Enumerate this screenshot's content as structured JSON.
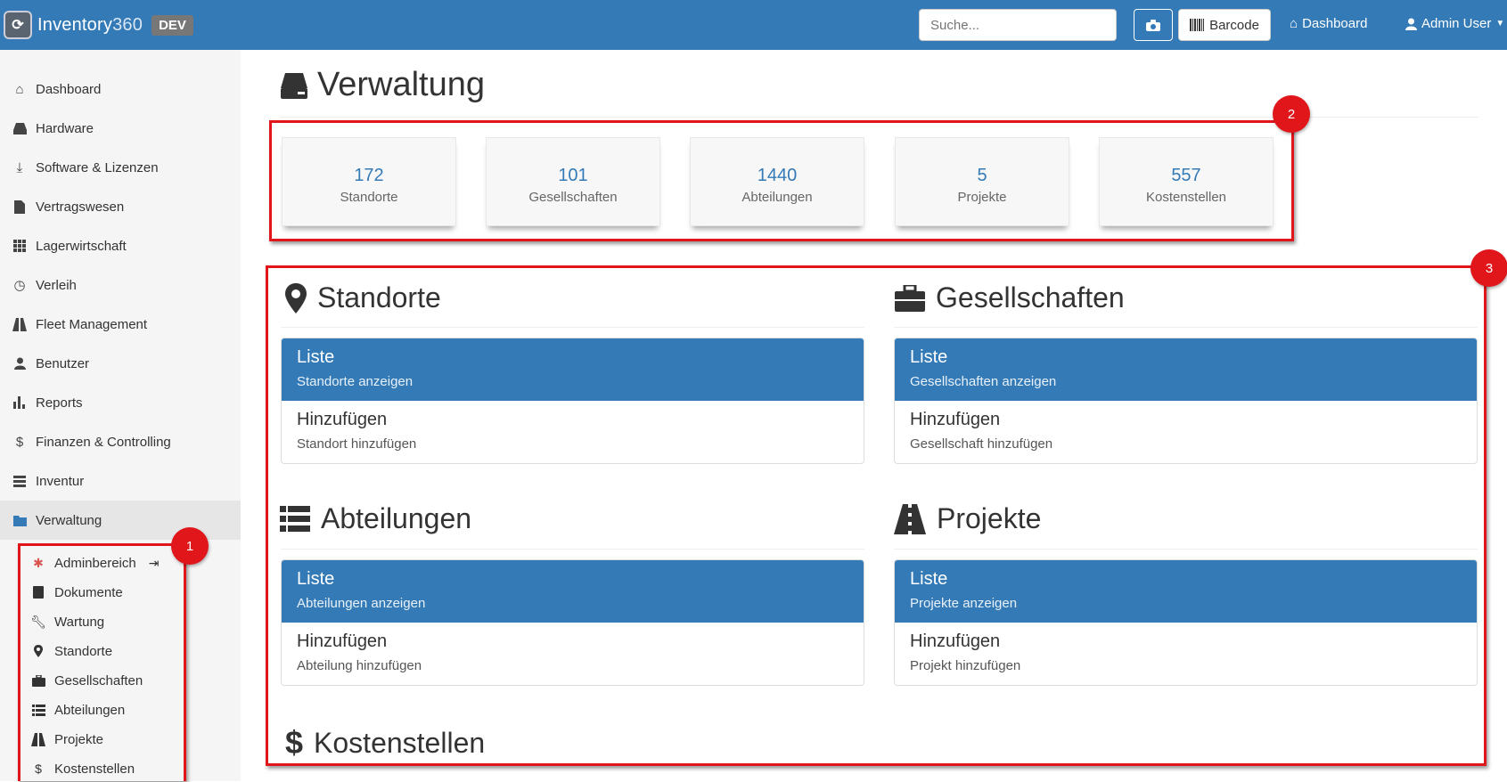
{
  "topbar": {
    "brand_name": "Inventory",
    "brand_num": "360",
    "env_badge": "DEV",
    "search_placeholder": "Suche...",
    "barcode_label": "Barcode",
    "dashboard_label": "Dashboard",
    "user_label": "Admin User"
  },
  "sidebar": {
    "items": [
      {
        "label": "Dashboard",
        "icon": "home-icon"
      },
      {
        "label": "Hardware",
        "icon": "drive-icon"
      },
      {
        "label": "Software & Lizenzen",
        "icon": "download-icon"
      },
      {
        "label": "Vertragswesen",
        "icon": "file-icon"
      },
      {
        "label": "Lagerwirtschaft",
        "icon": "grid-icon"
      },
      {
        "label": "Verleih",
        "icon": "clock-icon"
      },
      {
        "label": "Fleet Management",
        "icon": "road-icon"
      },
      {
        "label": "Benutzer",
        "icon": "user-icon"
      },
      {
        "label": "Reports",
        "icon": "chart-icon"
      },
      {
        "label": "Finanzen & Controlling",
        "icon": "dollar-icon"
      },
      {
        "label": "Inventur",
        "icon": "list-icon"
      },
      {
        "label": "Verwaltung",
        "icon": "folder-icon"
      }
    ],
    "subitems": [
      {
        "label": "Adminbereich",
        "icon": "cog-icon"
      },
      {
        "label": "Dokumente",
        "icon": "book-icon"
      },
      {
        "label": "Wartung",
        "icon": "wrench-icon"
      },
      {
        "label": "Standorte",
        "icon": "map-marker-icon"
      },
      {
        "label": "Gesellschaften",
        "icon": "briefcase-icon"
      },
      {
        "label": "Abteilungen",
        "icon": "list-icon"
      },
      {
        "label": "Projekte",
        "icon": "road-icon"
      },
      {
        "label": "Kostenstellen",
        "icon": "dollar-icon"
      }
    ]
  },
  "main": {
    "title": "Verwaltung",
    "stats": [
      {
        "value": "172",
        "label": "Standorte"
      },
      {
        "value": "101",
        "label": "Gesellschaften"
      },
      {
        "value": "1440",
        "label": "Abteilungen"
      },
      {
        "value": "5",
        "label": "Projekte"
      },
      {
        "value": "557",
        "label": "Kostenstellen"
      }
    ],
    "sections": [
      {
        "title": "Standorte",
        "icon": "map-marker-icon",
        "list_h": "Liste",
        "list_s": "Standorte anzeigen",
        "add_h": "Hinzufügen",
        "add_s": "Standort hinzufügen"
      },
      {
        "title": "Gesellschaften",
        "icon": "briefcase-icon",
        "list_h": "Liste",
        "list_s": "Gesellschaften anzeigen",
        "add_h": "Hinzufügen",
        "add_s": "Gesellschaft hinzufügen"
      },
      {
        "title": "Abteilungen",
        "icon": "list-icon",
        "list_h": "Liste",
        "list_s": "Abteilungen anzeigen",
        "add_h": "Hinzufügen",
        "add_s": "Abteilung hinzufügen"
      },
      {
        "title": "Projekte",
        "icon": "road-icon",
        "list_h": "Liste",
        "list_s": "Projekte anzeigen",
        "add_h": "Hinzufügen",
        "add_s": "Projekt hinzufügen"
      },
      {
        "title": "Kostenstellen",
        "icon": "dollar-icon"
      }
    ]
  },
  "annotations": {
    "one": "1",
    "two": "2",
    "three": "3",
    "color": "#e0161b"
  }
}
